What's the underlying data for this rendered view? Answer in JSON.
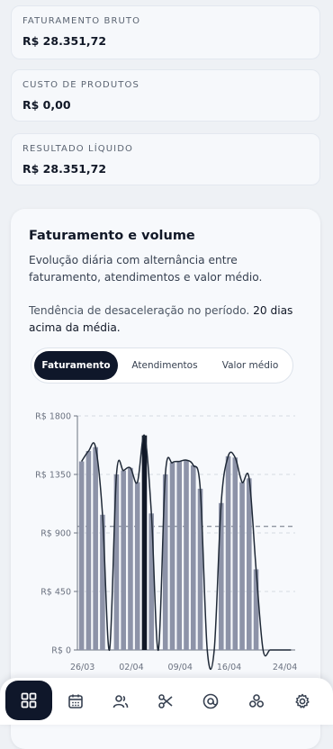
{
  "metrics": [
    {
      "label": "FATURAMENTO BRUTO",
      "value": "R$ 28.351,72"
    },
    {
      "label": "CUSTO DE PRODUTOS",
      "value": "R$ 0,00"
    },
    {
      "label": "RESULTADO LÍQUIDO",
      "value": "R$ 28.351,72"
    }
  ],
  "card": {
    "title": "Faturamento e volume",
    "description": "Evolução diária com alternância entre faturamento, atendimentos e valor médio.",
    "trend_text": "Tendência de desaceleração no período.",
    "trend_highlight": "20 dias acima da média."
  },
  "tabs": [
    {
      "label": "Faturamento",
      "active": true
    },
    {
      "label": "Atendimentos",
      "active": false
    },
    {
      "label": "Valor médio",
      "active": false
    }
  ],
  "chart_data": {
    "type": "bar",
    "title": "",
    "x_tick_labels": [
      "26/03",
      "02/04",
      "09/04",
      "16/04",
      "24/04"
    ],
    "y_tick_labels": [
      "R$ 0",
      "R$ 450",
      "R$ 900",
      "R$ 1350",
      "R$ 1800"
    ],
    "ylim": [
      0,
      1800
    ],
    "average": 950,
    "highlighted_index": 9,
    "values": [
      1450,
      1530,
      1560,
      1040,
      0,
      1350,
      1380,
      1400,
      1290,
      1650,
      1050,
      0,
      1350,
      1440,
      1450,
      1460,
      1420,
      1240,
      0,
      0,
      1130,
      1490,
      1480,
      1290,
      1320,
      620,
      0,
      0,
      0,
      0,
      0
    ],
    "grid": "horizontal dashed"
  },
  "nav": [
    {
      "icon": "dashboard-icon",
      "active": true
    },
    {
      "icon": "calendar-icon",
      "active": false
    },
    {
      "icon": "users-icon",
      "active": false
    },
    {
      "icon": "scissors-icon",
      "active": false
    },
    {
      "icon": "at-sign-icon",
      "active": false
    },
    {
      "icon": "circles-icon",
      "active": false
    },
    {
      "icon": "settings-icon",
      "active": false
    }
  ],
  "colors": {
    "accent": "#0f172a",
    "bar": "#8d93a8",
    "highlight_bar": "#111827",
    "line": "#1f2937"
  }
}
